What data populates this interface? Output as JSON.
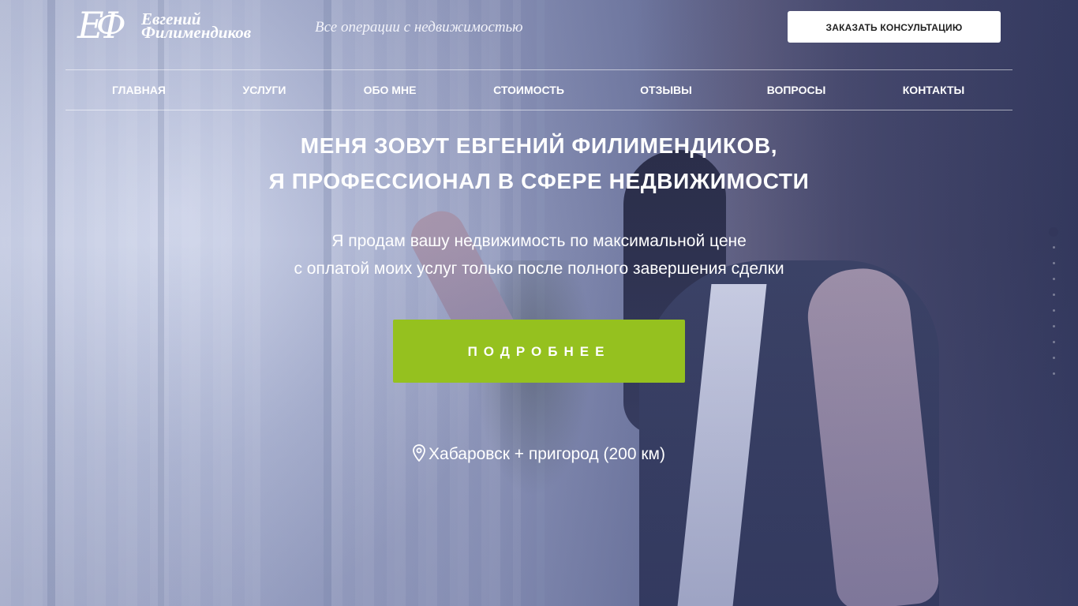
{
  "header": {
    "logo_monogram": "ЕФ",
    "logo_first_name": "Евгений",
    "logo_last_name": "Филимендиков",
    "tagline": "Все операции с недвижимостью",
    "consult_button": "ЗАКАЗАТЬ КОНСУЛЬТАЦИЮ"
  },
  "nav": {
    "items": [
      {
        "label": "ГЛАВНАЯ"
      },
      {
        "label": "УСЛУГИ"
      },
      {
        "label": "ОБО МНЕ"
      },
      {
        "label": "СТОИМОСТЬ"
      },
      {
        "label": "ОТЗЫВЫ"
      },
      {
        "label": "ВОПРОСЫ"
      },
      {
        "label": "КОНТАКТЫ"
      }
    ]
  },
  "hero": {
    "headline_line1": "МЕНЯ ЗОВУТ ЕВГЕНИЙ ФИЛИМЕНДИКОВ,",
    "headline_line2": "Я ПРОФЕССИОНАЛ В СФЕРЕ НЕДВИЖИМОСТИ",
    "subline_line1": "Я продам вашу недвижимость по максимальной цене",
    "subline_line2": "с оплатой моих услуг только после полного завершения сделки",
    "more_button": "ПОДРОБНЕЕ",
    "location": "Хабаровск + пригород (200 км)"
  },
  "pager": {
    "count": 10,
    "active_index": 0
  },
  "colors": {
    "accent_green": "#95c11f",
    "button_white": "#ffffff",
    "text": "#ffffff"
  }
}
